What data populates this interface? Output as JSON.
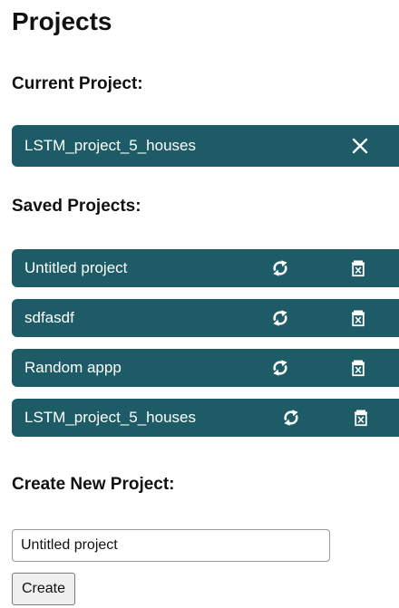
{
  "page": {
    "title": "Projects"
  },
  "current": {
    "heading": "Current Project:",
    "name": "LSTM_project_5_houses",
    "close_icon": "close-icon"
  },
  "saved": {
    "heading": "Saved Projects:",
    "items": [
      {
        "name": "Untitled project"
      },
      {
        "name": "sdfasdf"
      },
      {
        "name": "Random appp"
      },
      {
        "name": "LSTM_project_5_houses"
      }
    ],
    "reload_icon": "reload-icon",
    "delete_icon": "trash-icon"
  },
  "create": {
    "heading": "Create New Project:",
    "input_value": "Untitled project",
    "button_label": "Create"
  },
  "colors": {
    "bar_background": "#1d5c66",
    "bar_text": "#ffffff"
  }
}
